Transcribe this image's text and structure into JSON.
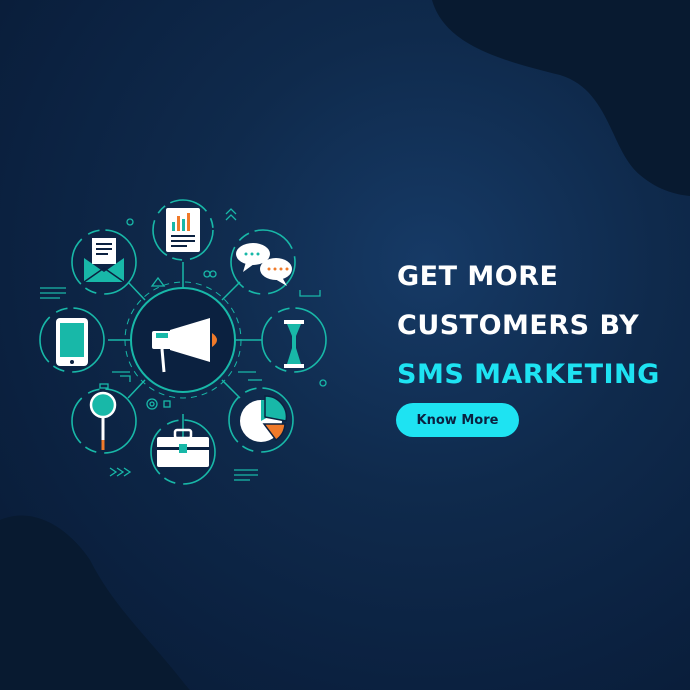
{
  "headline": {
    "line1": "GET MORE",
    "line2": "CUSTOMERS BY",
    "line3": "SMS MARKETING"
  },
  "cta": {
    "label": "Know More"
  },
  "colors": {
    "accent": "#1ee3f2",
    "teal": "#18b8a8",
    "orange": "#f07a2a",
    "background": "#0f2a4c",
    "dark_blob": "#081a30"
  },
  "icons": [
    "megaphone-icon",
    "report-chart-icon",
    "chat-bubbles-icon",
    "hourglass-icon",
    "pie-chart-icon",
    "briefcase-icon",
    "magnifier-icon",
    "smartphone-icon",
    "email-icon"
  ]
}
